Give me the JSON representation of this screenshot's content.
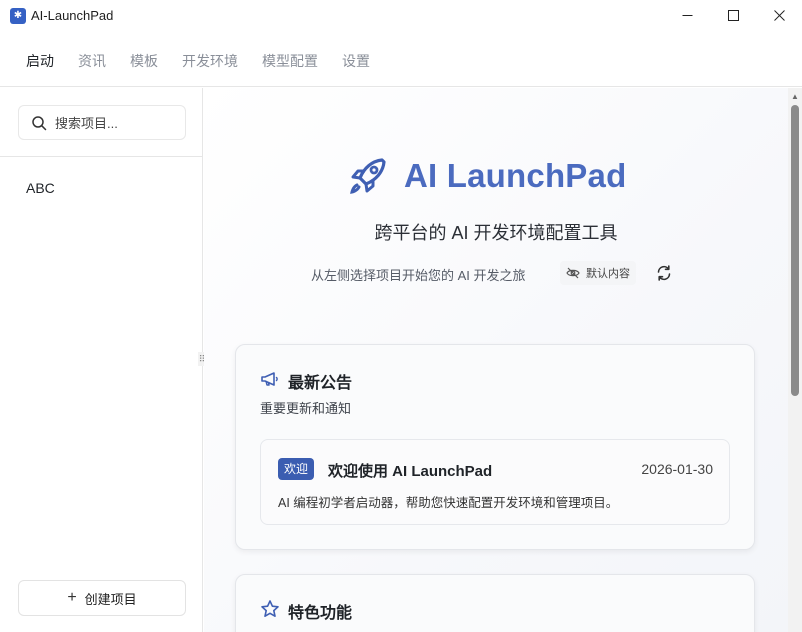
{
  "window": {
    "title": "AI-LaunchPad",
    "minimize": "─",
    "maximize": "☐",
    "close": "✕"
  },
  "menu": {
    "items": [
      {
        "label": "启动",
        "active": true
      },
      {
        "label": "资讯",
        "active": false
      },
      {
        "label": "模板",
        "active": false
      },
      {
        "label": "开发环境",
        "active": false
      },
      {
        "label": "模型配置",
        "active": false
      },
      {
        "label": "设置",
        "active": false
      }
    ]
  },
  "sidebar": {
    "search_placeholder": "搜索项目...",
    "projects": [
      {
        "name": "ABC"
      }
    ],
    "create_label": "创建项目",
    "create_icon": "plus-icon"
  },
  "hero": {
    "title": "AI LaunchPad",
    "subtitle": "跨平台的 AI 开发环境配置工具",
    "tagline": "从左侧选择项目开始您的 AI 开发之旅",
    "default_content_label": "默认内容",
    "logo_icon": "rocket-icon",
    "refresh_icon": "refresh-icon",
    "eye_off_icon": "eye-off-icon"
  },
  "announcements": {
    "title": "最新公告",
    "description": "重要更新和通知",
    "icon": "megaphone-icon",
    "items": [
      {
        "badge": "欢迎",
        "title": "欢迎使用 AI LaunchPad",
        "date": "2026-01-30",
        "body": "AI 编程初学者启动器，帮助您快速配置开发环境和管理项目。"
      }
    ]
  },
  "features": {
    "title": "特色功能",
    "icon": "star-icon"
  },
  "colors": {
    "accent": "#4b6bbf",
    "badge": "#3b5db1"
  }
}
